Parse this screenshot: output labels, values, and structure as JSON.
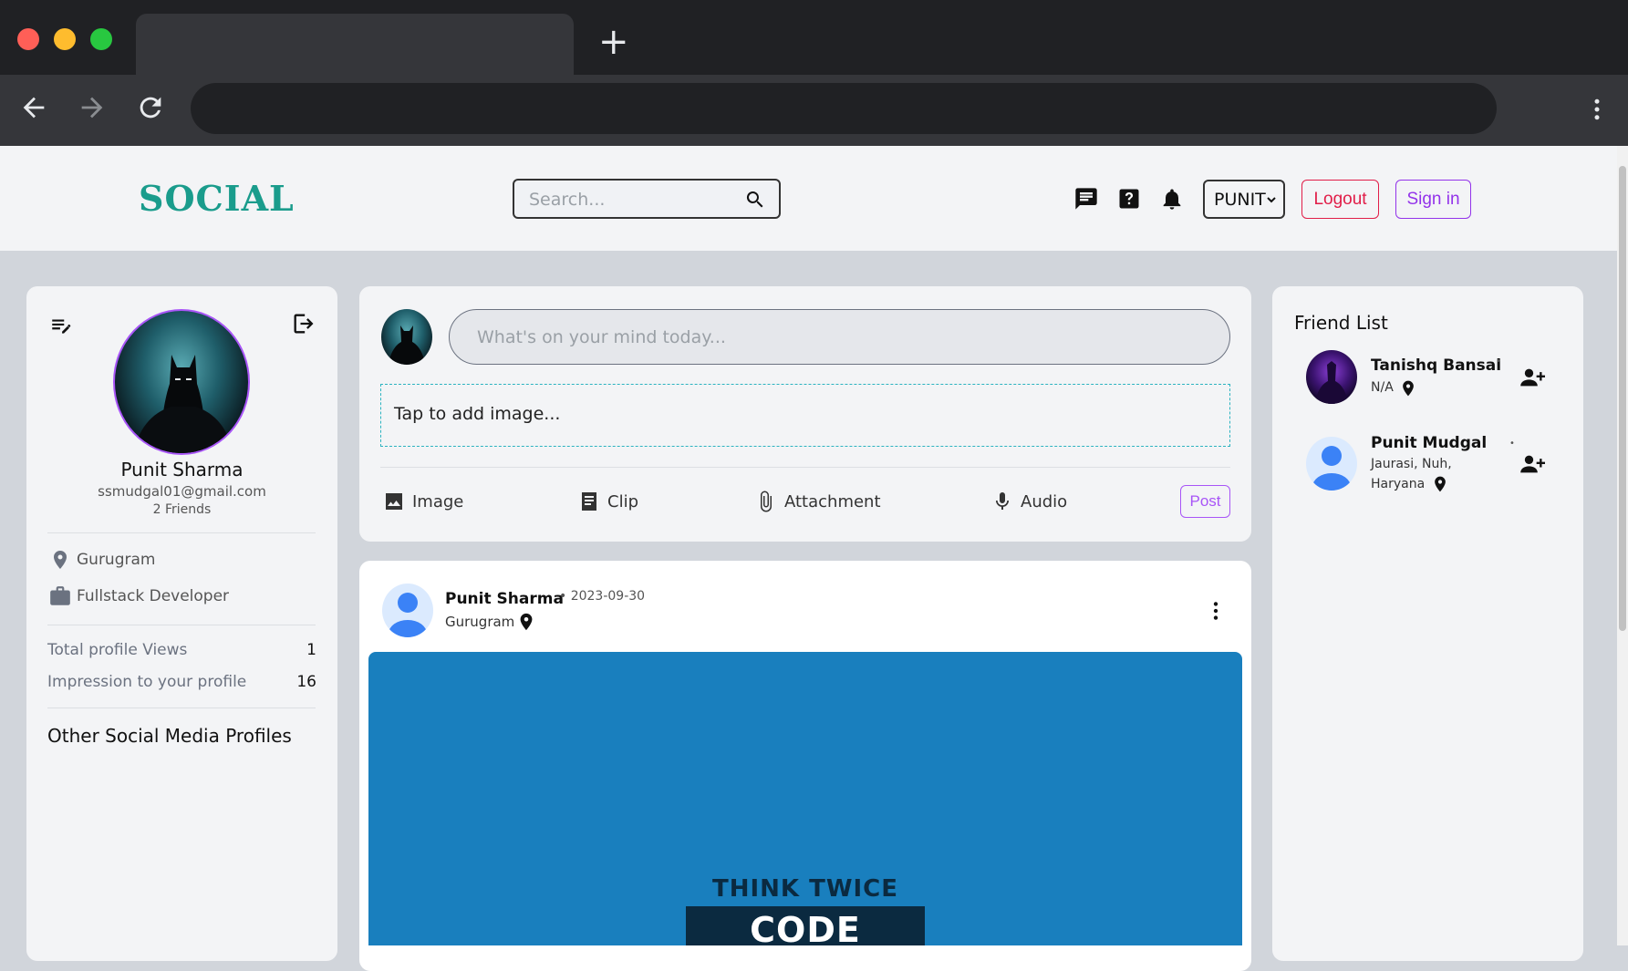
{
  "browser": {
    "new_tab_symbol": "+"
  },
  "header": {
    "logo": "SOCIAL",
    "search_placeholder": "Search...",
    "user_select": "PUNIT",
    "logout_label": "Logout",
    "signin_label": "Sign in"
  },
  "profile": {
    "name": "Punit Sharma",
    "email": "ssmudgal01@gmail.com",
    "friends": "2 Friends",
    "location": "Gurugram",
    "occupation": "Fullstack Developer",
    "stats": [
      {
        "label": "Total profile Views",
        "value": "1"
      },
      {
        "label": "Impression to your profile",
        "value": "16"
      }
    ],
    "other_profiles_title": "Other Social Media Profiles"
  },
  "composer": {
    "placeholder": "What's on your mind today...",
    "dropzone_text": "Tap to add image...",
    "actions": [
      "Image",
      "Clip",
      "Attachment",
      "Audio"
    ],
    "post_label": "Post"
  },
  "post": {
    "author": "Punit Sharma",
    "date": "• 2023-09-30",
    "location": "Gurugram",
    "image_text_top": "THINK TWICE",
    "image_text_bottom": "CODE ONCE!"
  },
  "friends": {
    "title": "Friend List",
    "items": [
      {
        "name": "Tanishq Bansal",
        "location_line1": "N/A",
        "location_line2": "",
        "dot": "•"
      },
      {
        "name": "Punit Mudgal",
        "location_line1": "Jaurasi, Nuh,",
        "location_line2": "Haryana",
        "dot": "•"
      }
    ]
  },
  "colors": {
    "logo": "#1a9c8c",
    "logout": "#e11d48",
    "signin": "#9333ea",
    "post_image_bg": "#197fbe"
  }
}
